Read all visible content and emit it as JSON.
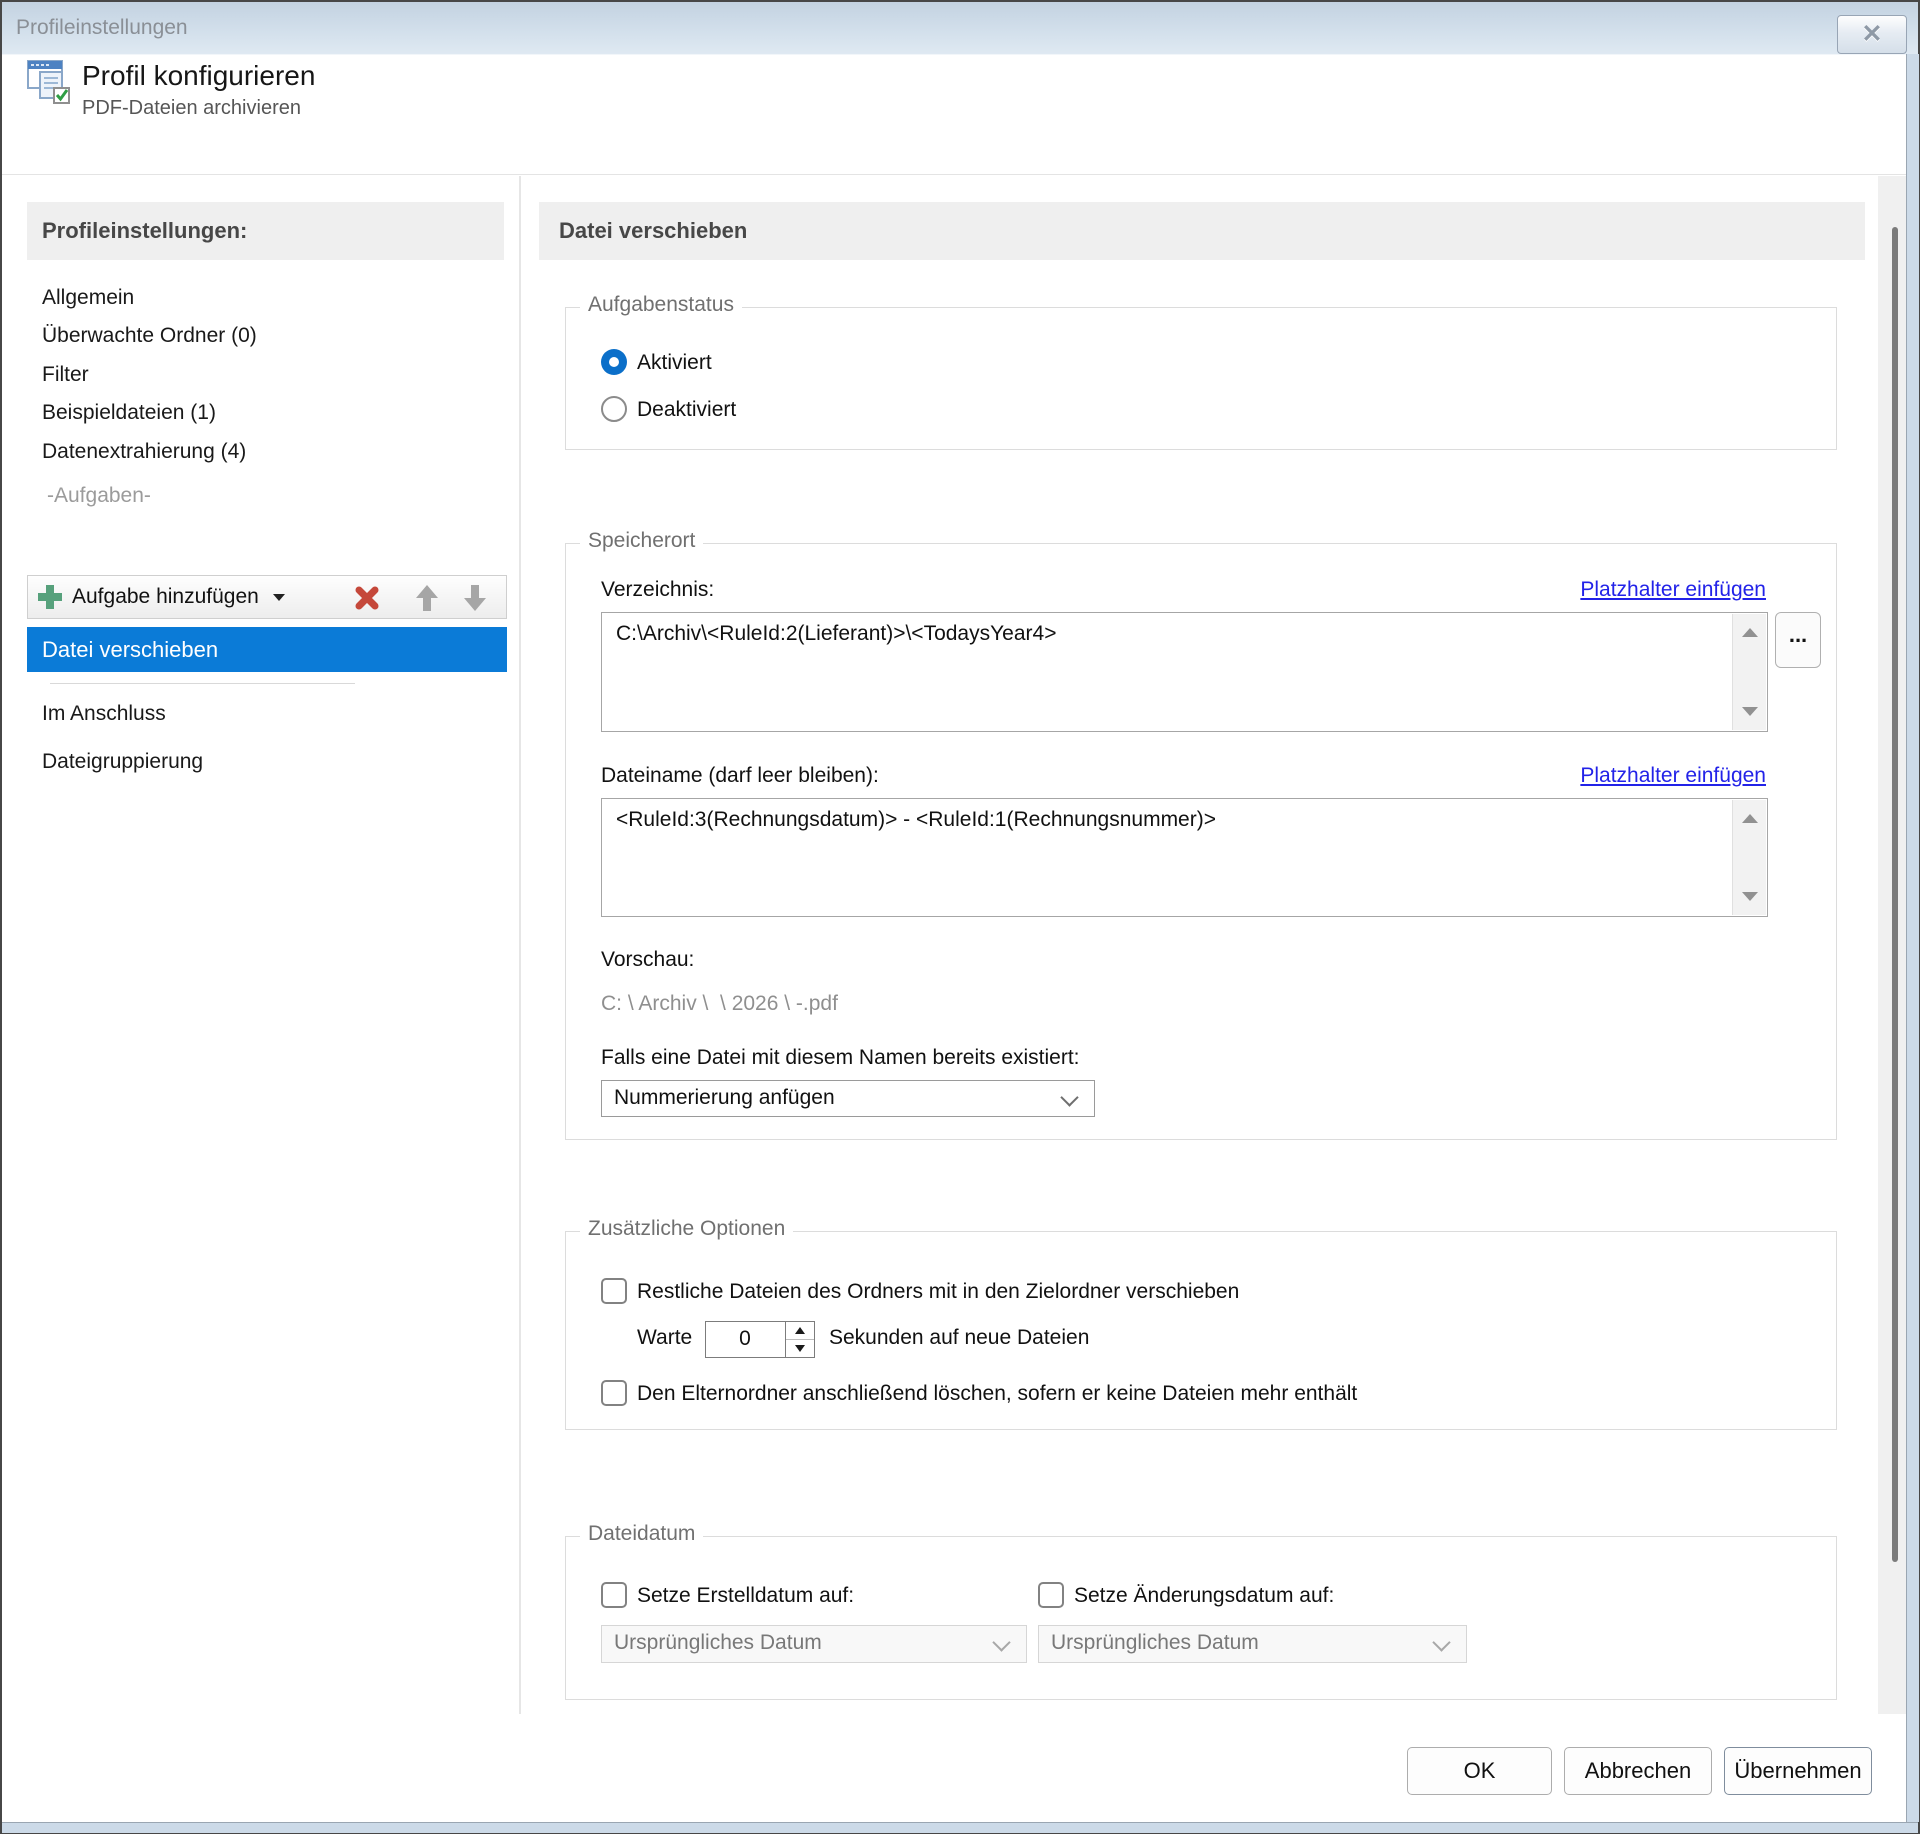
{
  "window": {
    "title": "Profileinstellungen",
    "close_glyph": "✕"
  },
  "header": {
    "title": "Profil konfigurieren",
    "subtitle": "PDF-Dateien archivieren"
  },
  "sidebar": {
    "heading": "Profileinstellungen:",
    "items": [
      {
        "label": "Allgemein"
      },
      {
        "label": "Überwachte Ordner (0)"
      },
      {
        "label": "Filter"
      },
      {
        "label": "Beispieldateien (1)"
      },
      {
        "label": "Datenextrahierung (4)"
      }
    ],
    "tasks_section_label": "-Aufgaben-",
    "toolbar": {
      "add_task_label": "Aufgabe hinzufügen"
    },
    "selected_task": {
      "label": "Datei verschieben"
    },
    "footer_items": [
      {
        "label": "Im Anschluss"
      },
      {
        "label": "Dateigruppierung"
      }
    ]
  },
  "main": {
    "heading": "Datei verschieben",
    "task_status": {
      "legend": "Aufgabenstatus",
      "enabled_label": "Aktiviert",
      "disabled_label": "Deaktiviert"
    },
    "storage": {
      "legend": "Speicherort",
      "directory_label": "Verzeichnis:",
      "placeholder_link": "Platzhalter einfügen",
      "directory_value": "C:\\Archiv\\<RuleId:2(Lieferant)>\\<TodaysYear4>",
      "browse_label": "...",
      "filename_label": "Dateiname (darf leer bleiben):",
      "filename_value": "<RuleId:3(Rechnungsdatum)> - <RuleId:1(Rechnungsnummer)>",
      "preview_label": "Vorschau:",
      "preview_value": "C: \\ Archiv \\  \\ 2026 \\ -.pdf",
      "exists_label": "Falls eine Datei mit diesem Namen bereits existiert:",
      "exists_value": "Nummerierung anfügen"
    },
    "options": {
      "legend": "Zusätzliche Optionen",
      "move_rest_label": "Restliche Dateien des Ordners mit in den Zielordner verschieben",
      "wait_prefix": "Warte",
      "wait_value": "0",
      "wait_suffix": "Sekunden auf neue Dateien",
      "delete_parent_label": "Den Elternordner anschließend löschen, sofern er keine Dateien mehr enthält"
    },
    "file_date": {
      "legend": "Dateidatum",
      "created_label": "Setze Erstelldatum auf:",
      "created_value": "Ursprüngliches Datum",
      "modified_label": "Setze Änderungsdatum auf:",
      "modified_value": "Ursprüngliches Datum"
    }
  },
  "footer": {
    "ok": "OK",
    "cancel": "Abbrechen",
    "apply": "Übernehmen"
  },
  "colors": {
    "accent": "#0b7bd7",
    "link": "#2222e8",
    "plus_green": "#57a17c",
    "delete_red": "#c5483a"
  }
}
